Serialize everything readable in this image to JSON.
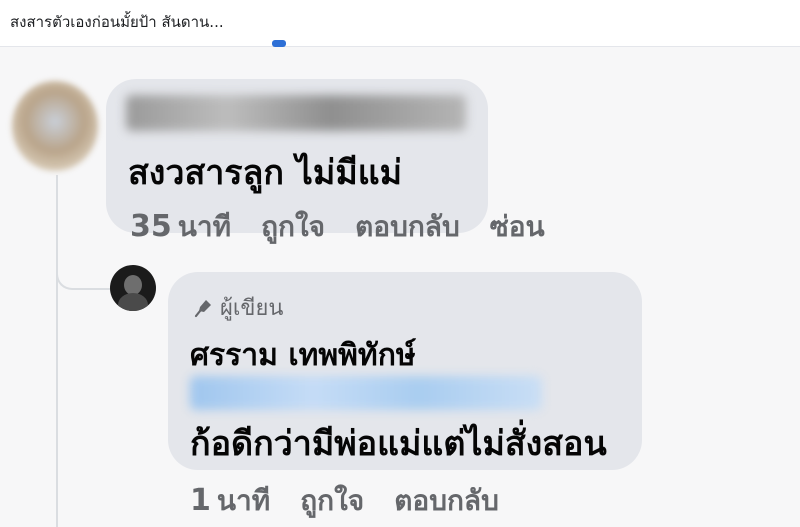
{
  "header": {
    "title": "สงสารตัวเองก่อนมั้ยป้า สันดาน...",
    "accent_color": "#2d6fd6"
  },
  "comment1": {
    "author_name": "",
    "text": "สงวสารลูก ไม่มีแม่",
    "time_number": "35",
    "time_unit": "นาที",
    "like_label": "ถูกใจ",
    "reply_label": "ตอบกลับ",
    "hide_label": "ซ่อน"
  },
  "reply1": {
    "badge_icon": "microphone-icon",
    "badge_label": "ผู้เขียน",
    "author_name": "ศรราม เทพพิทักษ์",
    "mention_name": "",
    "text": "ก้อดีกว่ามีพ่อแม่แต่ไม่สั่งสอน",
    "time_number": "1",
    "time_unit": "นาที",
    "like_label": "ถูกใจ",
    "reply_label": "ตอบกลับ"
  },
  "colors": {
    "bubble": "#e4e6eb",
    "meta_text": "#65676b",
    "mention_blur": "#b3d3f3"
  }
}
